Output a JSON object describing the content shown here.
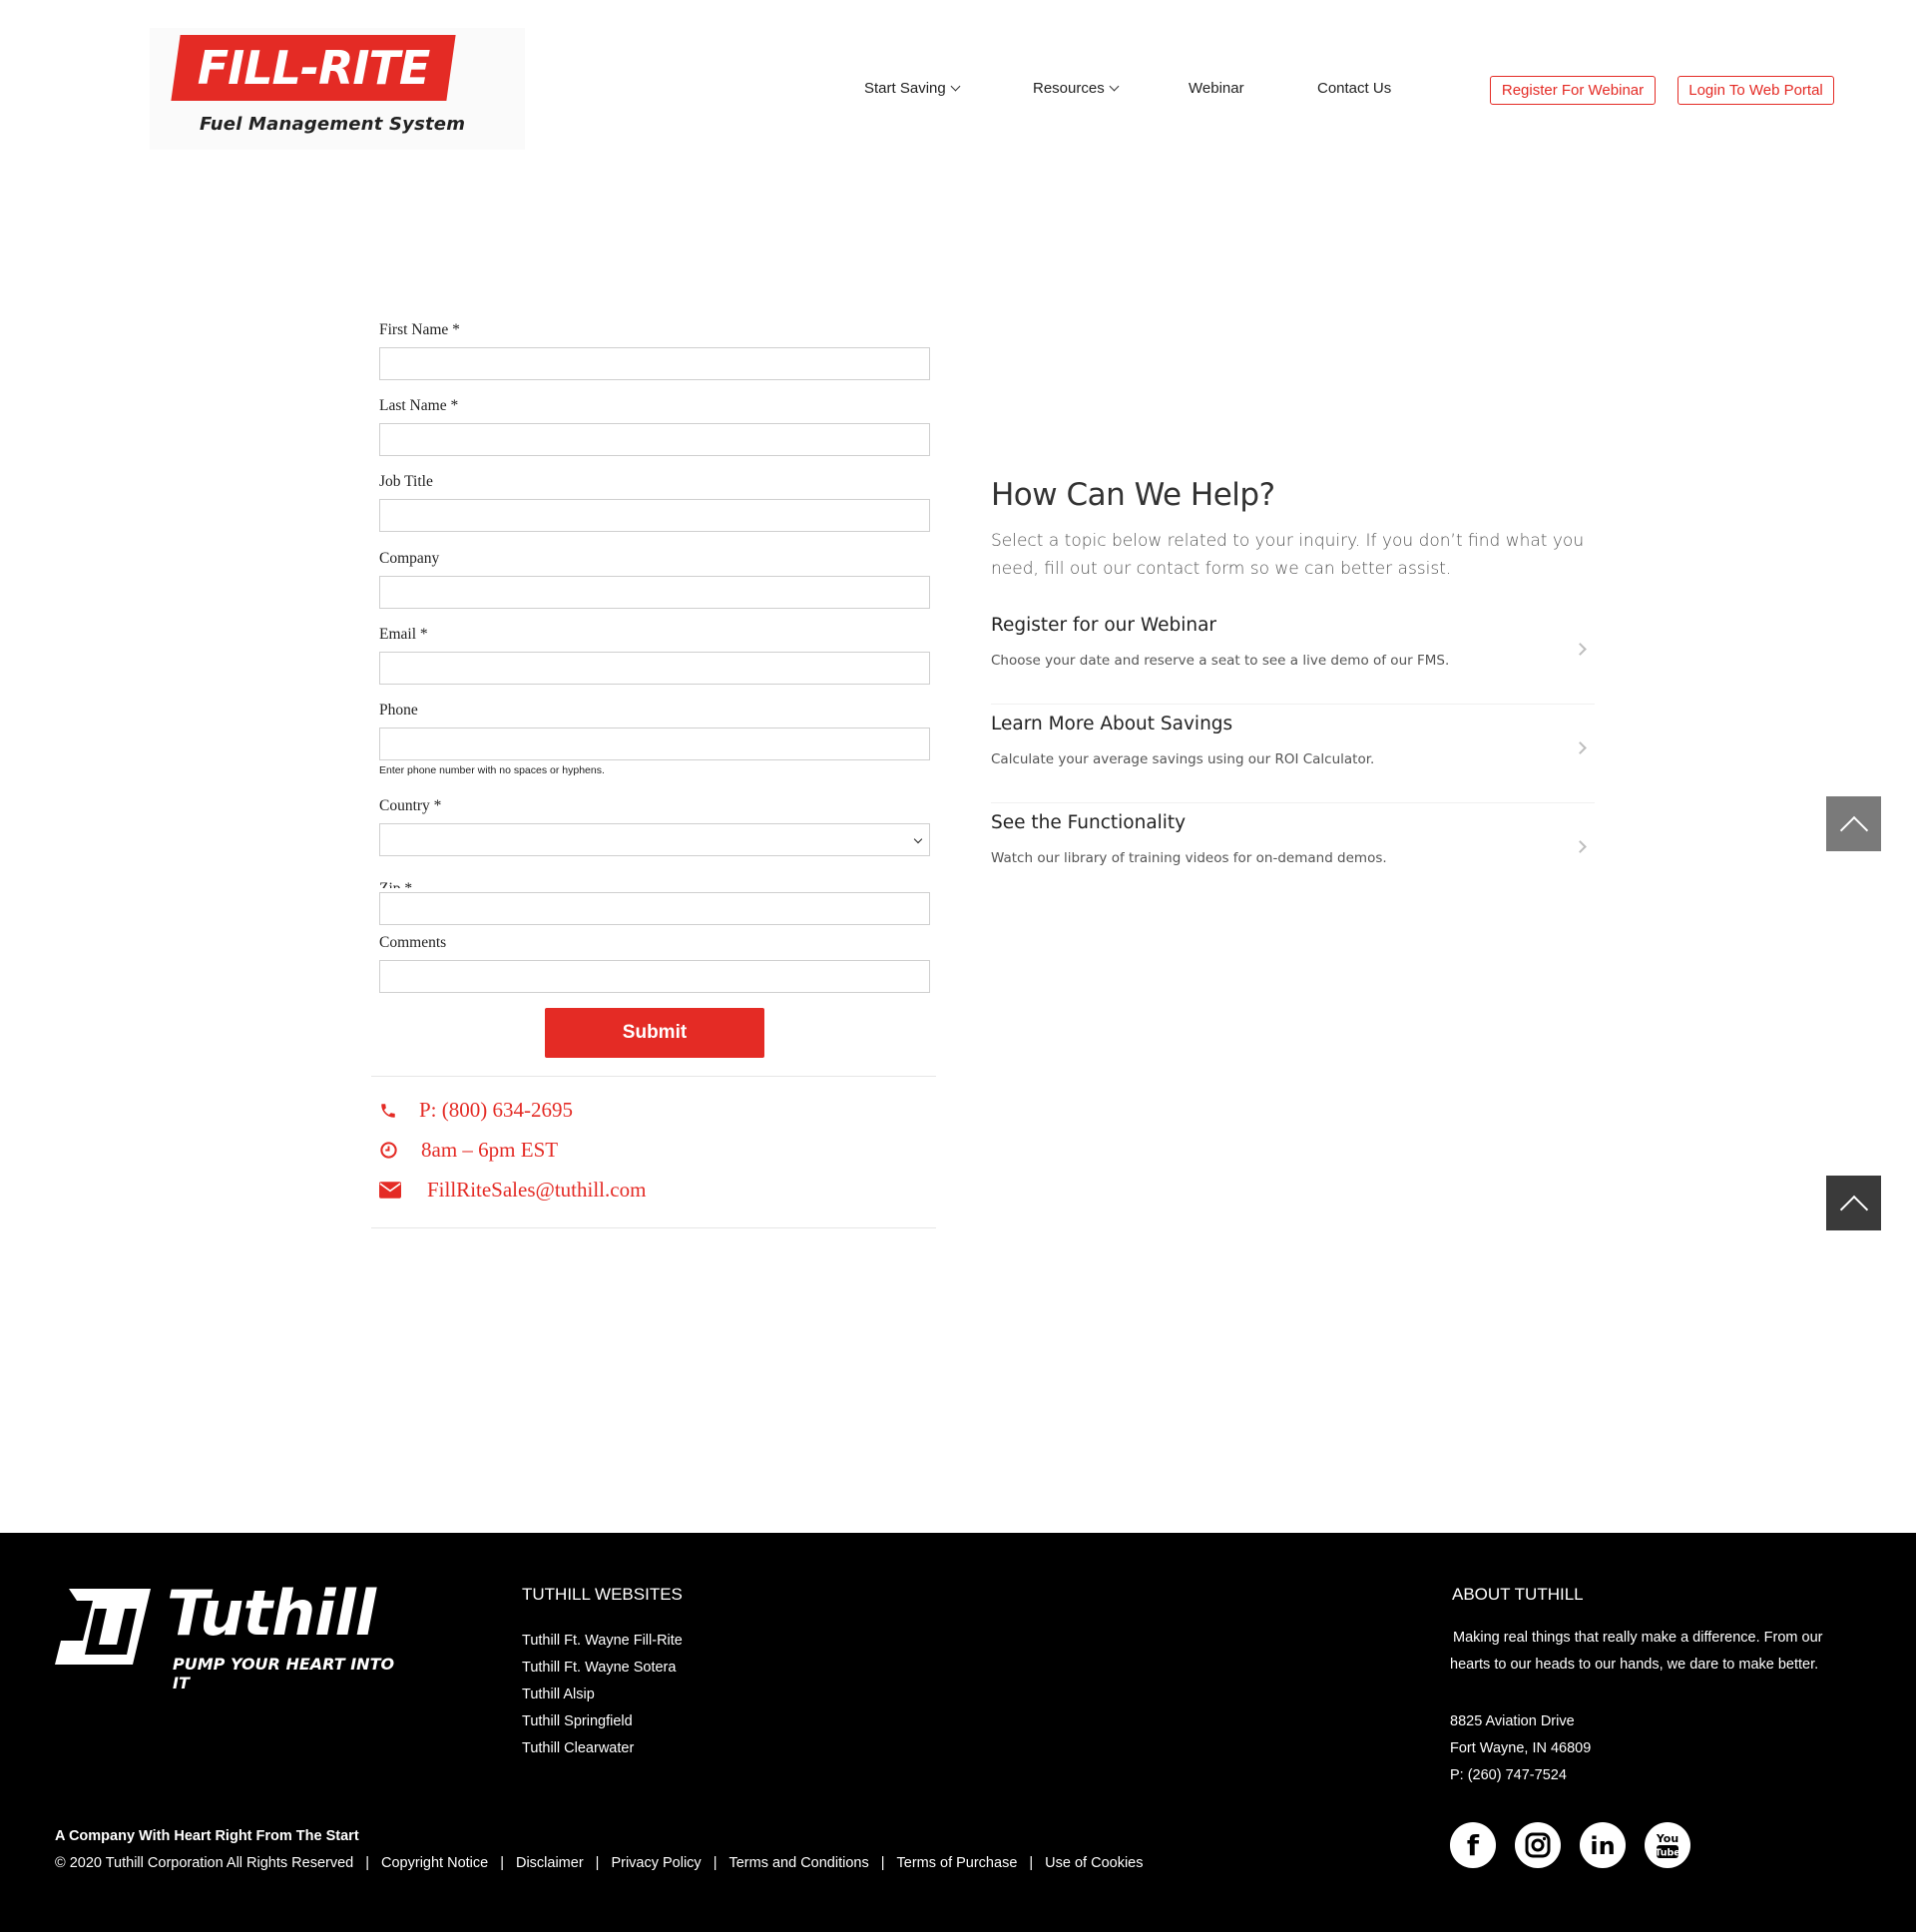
{
  "logo": {
    "brand": "FILL-RITE",
    "subtitle": "Fuel Management System"
  },
  "nav": {
    "items": [
      {
        "label": "Start Saving",
        "has_dropdown": true
      },
      {
        "label": "Resources",
        "has_dropdown": true
      },
      {
        "label": "Webinar",
        "has_dropdown": false
      },
      {
        "label": "Contact Us",
        "has_dropdown": false
      }
    ],
    "register_button": "Register For Webinar",
    "login_button": "Login To Web Portal"
  },
  "form": {
    "fields": {
      "first_name": {
        "label": "First Name *",
        "value": ""
      },
      "last_name": {
        "label": "Last Name *",
        "value": ""
      },
      "job_title": {
        "label": "Job Title",
        "value": ""
      },
      "company": {
        "label": "Company",
        "value": ""
      },
      "email": {
        "label": "Email *",
        "value": ""
      },
      "phone": {
        "label": "Phone",
        "value": "",
        "hint": "Enter phone number with no spaces or hyphens."
      },
      "country": {
        "label": "Country *",
        "selected": ""
      },
      "zip": {
        "label": "Zip *",
        "value": ""
      },
      "comments": {
        "label": "Comments",
        "value": ""
      }
    },
    "submit_label": "Submit"
  },
  "contact": {
    "phone": "P: (800) 634-2695",
    "hours": "8am – 6pm EST",
    "email": "FillRiteSales@tuthill.com"
  },
  "help": {
    "title": "How Can We Help?",
    "intro": "Select a topic below related to your inquiry. If you don’t find what you need, fill out our contact form so we can better assist.",
    "topics": [
      {
        "title": "Register for our Webinar",
        "desc": "Choose your date and reserve a seat to see a live demo of our FMS."
      },
      {
        "title": "Learn More About Savings",
        "desc": "Calculate your average savings using our ROI Calculator."
      },
      {
        "title": "See the Functionality",
        "desc": "Watch our library of training videos for on-demand demos."
      }
    ]
  },
  "footer": {
    "logo_word": "Tuthill",
    "logo_tagline": "PUMP YOUR HEART INTO IT",
    "websites_heading": "TUTHILL WEBSITES",
    "websites": [
      "Tuthill Ft. Wayne Fill-Rite",
      "Tuthill Ft. Wayne Sotera",
      "Tuthill Alsip",
      "Tuthill Springfield",
      "Tuthill Clearwater"
    ],
    "about_heading": "ABOUT TUTHILL",
    "about_text": "Making real things that really make a difference. From our hearts to our heads to our hands, we dare to make better.",
    "address_line1": "8825 Aviation Drive",
    "address_line2": "Fort Wayne, IN 46809",
    "phone": "P: (260) 747-7524",
    "tagline": "A Company With Heart Right From The Start",
    "copyright": "© 2020 Tuthill Corporation All Rights Reserved",
    "legal_links": [
      "Copyright Notice",
      "Disclaimer",
      "Privacy Policy",
      "Terms and Conditions",
      "Terms of Purchase",
      "Use of Cookies"
    ],
    "social": [
      "facebook-icon",
      "instagram-icon",
      "linkedin-icon",
      "youtube-icon"
    ]
  },
  "colors": {
    "brand_red": "#e42b25",
    "footer_bg": "#000000",
    "scroll_top_light": "#7a7a7a",
    "scroll_top_dark": "#3a3a3a"
  }
}
